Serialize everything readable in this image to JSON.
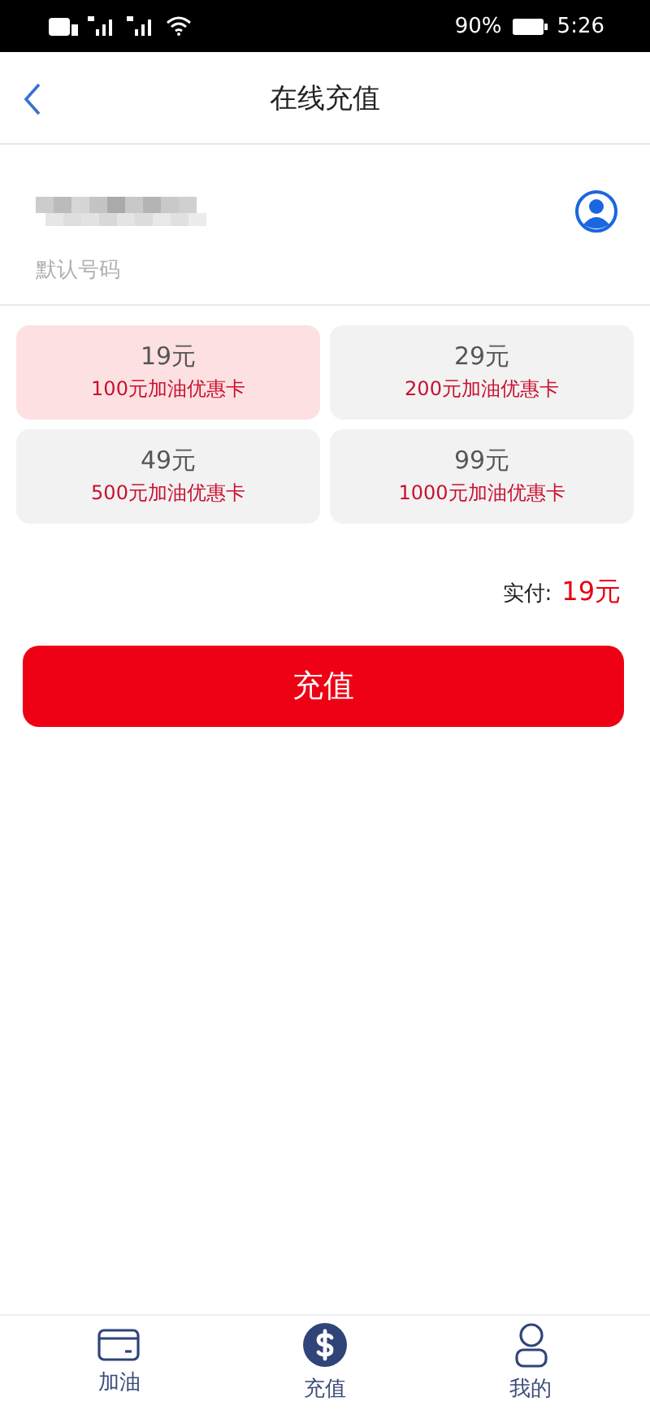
{
  "status_bar": {
    "battery_text": "90%",
    "time": "5:26"
  },
  "header": {
    "title": "在线充值"
  },
  "phone": {
    "hint": "默认号码"
  },
  "options": [
    {
      "price": "19元",
      "bonus": "100元加油优惠卡",
      "selected": true
    },
    {
      "price": "29元",
      "bonus": "200元加油优惠卡",
      "selected": false
    },
    {
      "price": "49元",
      "bonus": "500元加油优惠卡",
      "selected": false
    },
    {
      "price": "99元",
      "bonus": "1000元加油优惠卡",
      "selected": false
    }
  ],
  "payment": {
    "label": "实付:",
    "amount": "19元"
  },
  "submit_button": "充值",
  "tabs": [
    {
      "kind": "card",
      "label": "加油",
      "selected": false
    },
    {
      "kind": "dollar",
      "label": "充值",
      "selected": true
    },
    {
      "kind": "person",
      "label": "我的",
      "selected": false
    }
  ]
}
